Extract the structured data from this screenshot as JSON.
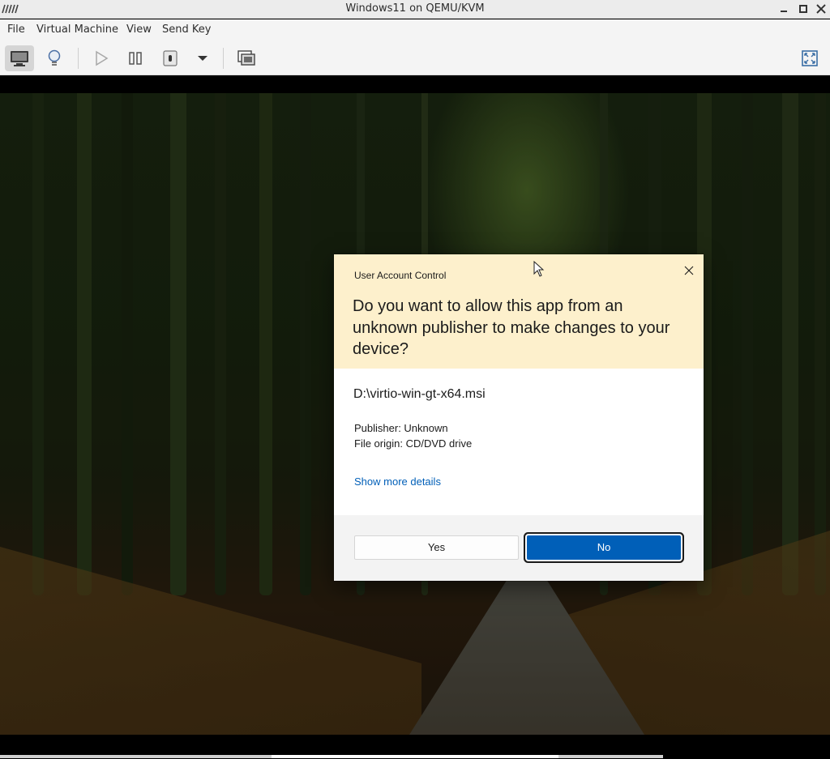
{
  "window": {
    "title": "Windows11 on QEMU/KVM"
  },
  "menu": {
    "items": [
      "File",
      "Virtual Machine",
      "View",
      "Send Key"
    ]
  },
  "toolbar": {
    "buttons": [
      "console-view",
      "details-view",
      "run",
      "pause",
      "shutdown",
      "shutdown-menu",
      "snapshots",
      "fullscreen"
    ]
  },
  "uac": {
    "caption": "User Account Control",
    "question": "Do you want to allow this app from an unknown publisher to make changes to your device?",
    "file": "D:\\virtio-win-gt-x64.msi",
    "publisher": "Publisher: Unknown",
    "origin": "File origin: CD/DVD drive",
    "details_link": "Show more details",
    "yes_label": "Yes",
    "no_label": "No"
  },
  "colors": {
    "accent": "#005fb8",
    "uac_header": "#fdf0cc"
  }
}
